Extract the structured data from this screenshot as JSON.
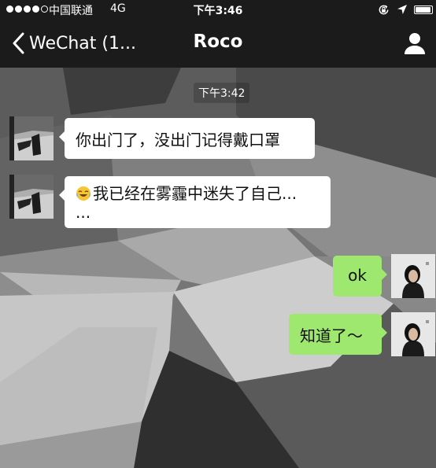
{
  "status_bar": {
    "carrier": "中国联通",
    "network": "4G",
    "time": "下午3:46",
    "signal_bars": 4,
    "signal_total": 5,
    "battery_level": 0.95
  },
  "nav": {
    "back_label": "WeChat (1...",
    "title": "Roco",
    "back_icon": "chevron-left-icon",
    "profile_icon": "person-icon"
  },
  "chat": {
    "timestamp": "下午3:42",
    "messages": [
      {
        "side": "left",
        "text": "你出门了，没出门记得戴口罩"
      },
      {
        "side": "left",
        "emoji": "crying-laughing-emoji",
        "text": "我已经在雾霾中迷失了自己...",
        "text2": "..."
      },
      {
        "side": "right",
        "text": "ok"
      },
      {
        "side": "right",
        "text": "知道了～"
      }
    ]
  },
  "colors": {
    "bar_bg": "#1b1b1b",
    "sent_bubble": "#9fe870",
    "received_bubble": "#ffffff"
  }
}
